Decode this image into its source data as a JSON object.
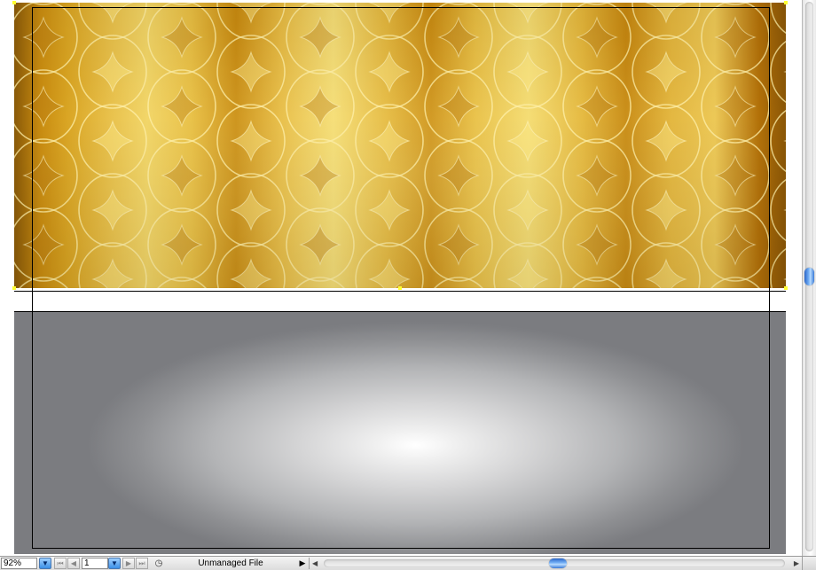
{
  "document": {
    "placed_image": "gold-retro-pattern",
    "background_panel": "grey-radial-gradient"
  },
  "colors": {
    "gold_dark": "#8a5a08",
    "gold_light": "#f4dc75",
    "grey_outer": "#7b7c80",
    "selection": "#ffff33",
    "scroll_blue": "#3a7ad8"
  },
  "statusbar": {
    "zoom": "92%",
    "zoom_menu_icon": "▼",
    "first_page_icon": "⏮",
    "prev_page_icon": "◀",
    "page": "1",
    "page_menu_icon": "▼",
    "next_page_icon": "▶",
    "last_page_icon": "⏭",
    "status_icon": "◷",
    "status_text": "Unmanaged File",
    "status_menu_icon": "▶",
    "scroll_left_icon": "◀",
    "scroll_right_icon": "▶"
  }
}
